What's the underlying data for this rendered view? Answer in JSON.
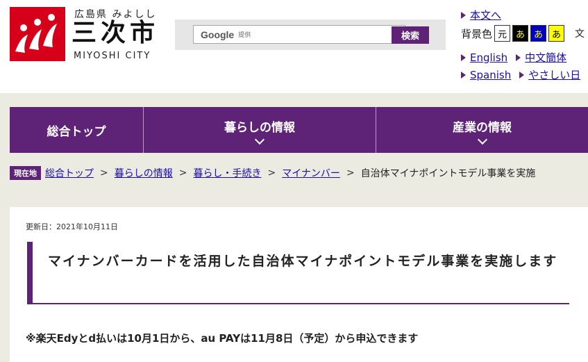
{
  "header": {
    "logo_pref": "広島県 みよしし",
    "logo_city": "三次市",
    "logo_city_en": "MIYOSHI CITY"
  },
  "search": {
    "google_label": "Google",
    "provided_label": "提供",
    "button_label": "検索"
  },
  "util": {
    "skip_link": "本文へ",
    "bg_color_label": "背景色",
    "bg_options": [
      {
        "label": "元",
        "color": "#ffffff"
      },
      {
        "label": "あ",
        "color": "#000000"
      },
      {
        "label": "あ",
        "color": "#0000cc"
      },
      {
        "label": "あ",
        "color": "#ffff00"
      }
    ],
    "text_size_partial": "文",
    "lang_english": "English",
    "lang_chinese": "中文簡体",
    "lang_spanish": "Spanish",
    "lang_easy": "やさしい日"
  },
  "nav": {
    "items": [
      {
        "label": "総合トップ"
      },
      {
        "label": "暮らしの情報"
      },
      {
        "label": "産業の情報"
      }
    ]
  },
  "breadcrumb": {
    "tag": "現在地",
    "items": [
      "総合トップ",
      "暮らしの情報",
      "暮らし・手続き",
      "マイナンバー"
    ],
    "current": "自治体マイナポイントモデル事業を実施"
  },
  "content": {
    "updated": "更新日：2021年10月11日",
    "title": "マイナンバーカードを活用した自治体マイナポイントモデル事業を実施します",
    "notice": "※楽天Edyとd払いは10月1日から、au PAYは11月8日（予定）から申込できます"
  },
  "colors": {
    "brand_purple": "#5e2376",
    "logo_red": "#d7001a",
    "page_bg": "#ecebe2"
  }
}
